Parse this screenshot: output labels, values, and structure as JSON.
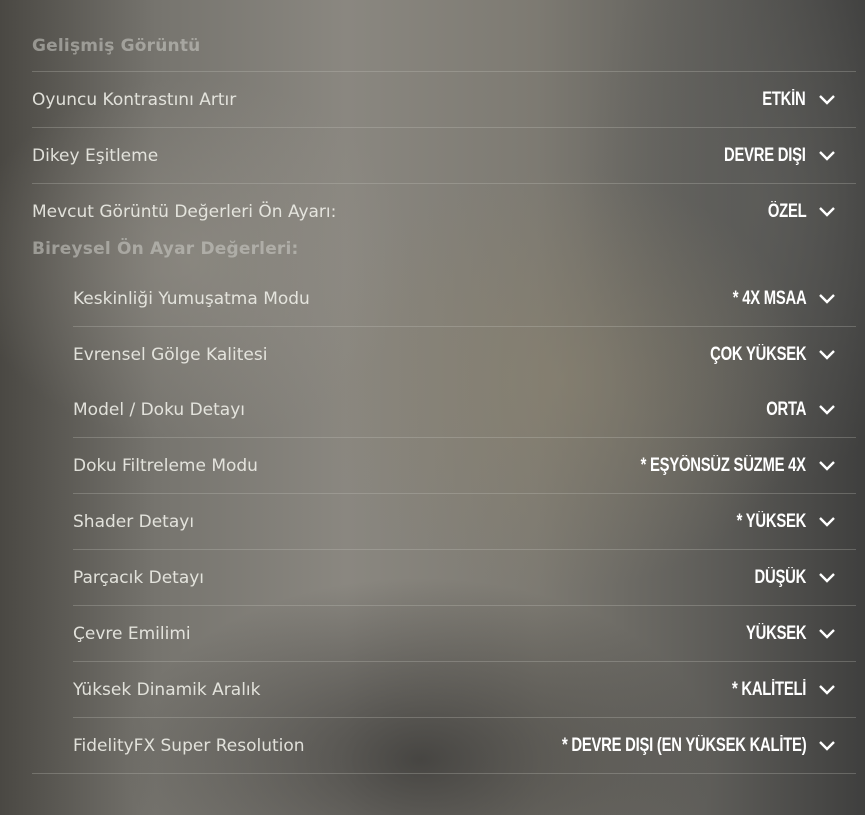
{
  "advanced_title": "Gelişmiş Görüntü",
  "settings": [
    {
      "label": "Oyuncu Kontrastını Artır",
      "value": "ETKİN"
    },
    {
      "label": "Dikey Eşitleme",
      "value": "DEVRE DIŞI"
    },
    {
      "label": "Mevcut Görüntü Değerleri Ön Ayarı:",
      "value": "ÖZEL"
    }
  ],
  "preset_title": "Bireysel Ön Ayar Değerleri:",
  "preset_settings": [
    {
      "label": "Keskinliği Yumuşatma Modu",
      "value": "* 4X MSAA"
    },
    {
      "label": "Evrensel Gölge Kalitesi",
      "value": "ÇOK YÜKSEK"
    },
    {
      "label": "Model / Doku Detayı",
      "value": "ORTA"
    },
    {
      "label": "Doku Filtreleme Modu",
      "value": "* EŞYÖNSÜZ SÜZME 4X"
    },
    {
      "label": "Shader Detayı",
      "value": "* YÜKSEK"
    },
    {
      "label": "Parçacık Detayı",
      "value": "DÜŞÜK"
    },
    {
      "label": "Çevre Emilimi",
      "value": "YÜKSEK"
    },
    {
      "label": "Yüksek Dinamik Aralık",
      "value": "* KALİTELİ"
    },
    {
      "label": "FidelityFX Super Resolution",
      "value": "* DEVRE DIŞI (EN YÜKSEK KALİTE)"
    }
  ],
  "icons": {
    "dropdown": "chevron-down-icon"
  }
}
